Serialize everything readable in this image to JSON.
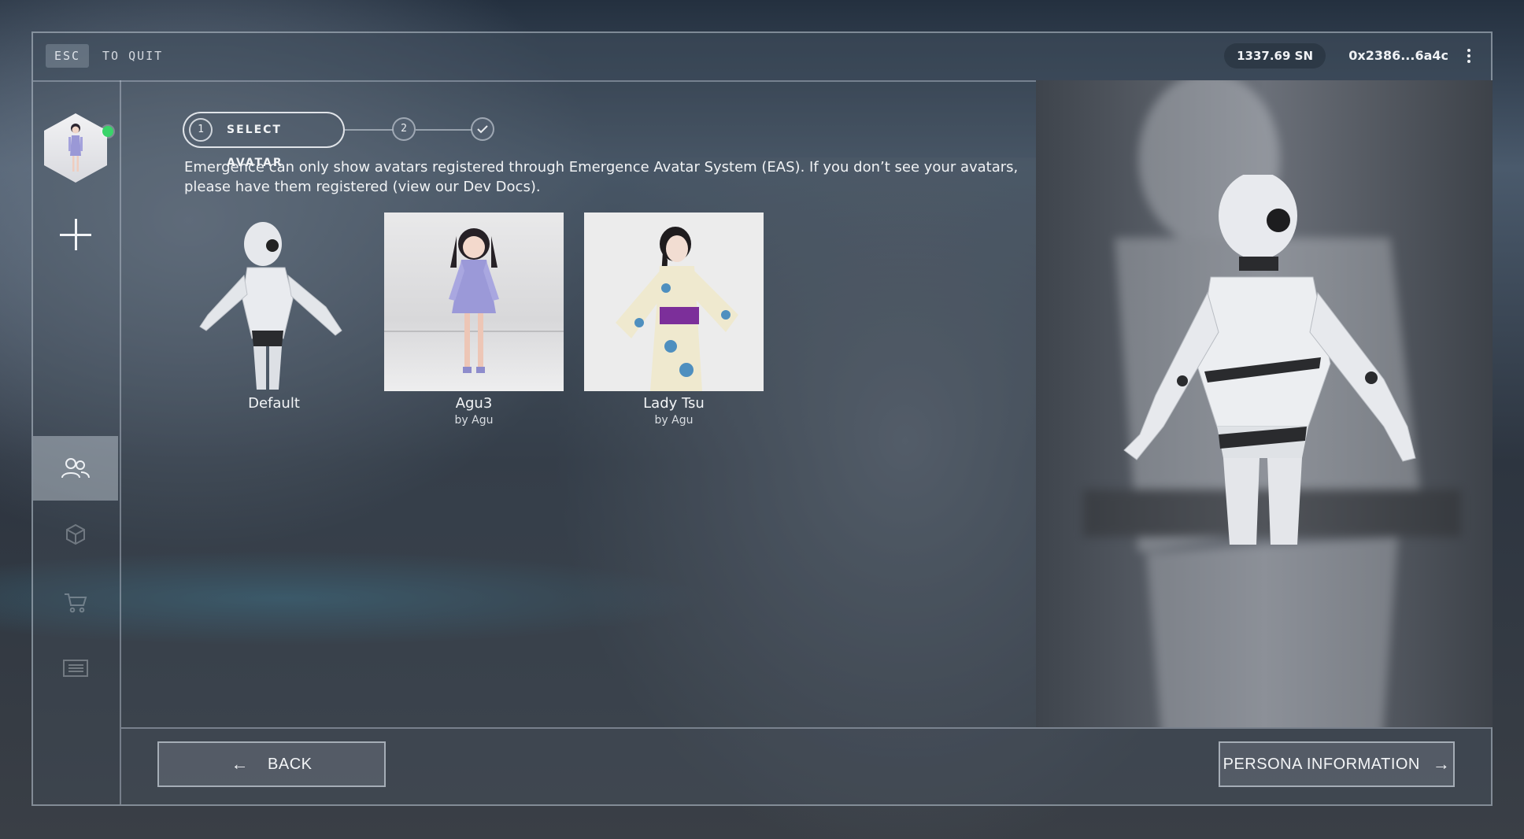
{
  "topbar": {
    "esc_key": "ESC",
    "quit_label": "TO QUIT",
    "balance": "1337.69 SN",
    "wallet_address": "0x2386...6a4c"
  },
  "sidebar": {
    "avatar_status": "online",
    "items": [
      {
        "icon": "people-icon",
        "active": true
      },
      {
        "icon": "cube-icon",
        "active": false
      },
      {
        "icon": "cart-icon",
        "active": false
      },
      {
        "icon": "news-icon",
        "active": false
      }
    ]
  },
  "stepper": {
    "steps": [
      {
        "number": "1",
        "label": "SELECT AVATAR",
        "state": "current"
      },
      {
        "number": "2",
        "state": "upcoming"
      },
      {
        "icon": "check-icon",
        "state": "final"
      }
    ]
  },
  "notice": "Emergence can only show avatars registered through Emergence Avatar System (EAS). If you don’t see your avatars, please have them registered (view our Dev Docs).",
  "avatars": [
    {
      "name": "Default",
      "creator": ""
    },
    {
      "name": "Agu3",
      "creator": "by Agu"
    },
    {
      "name": "Lady Tsu",
      "creator": "by Agu"
    }
  ],
  "footer": {
    "back_label": "BACK",
    "next_label": "PERSONA INFORMATION"
  },
  "colors": {
    "online": "#3ad46a",
    "frame_border": "#bec8d4",
    "active_nav": "#cdd4de"
  }
}
